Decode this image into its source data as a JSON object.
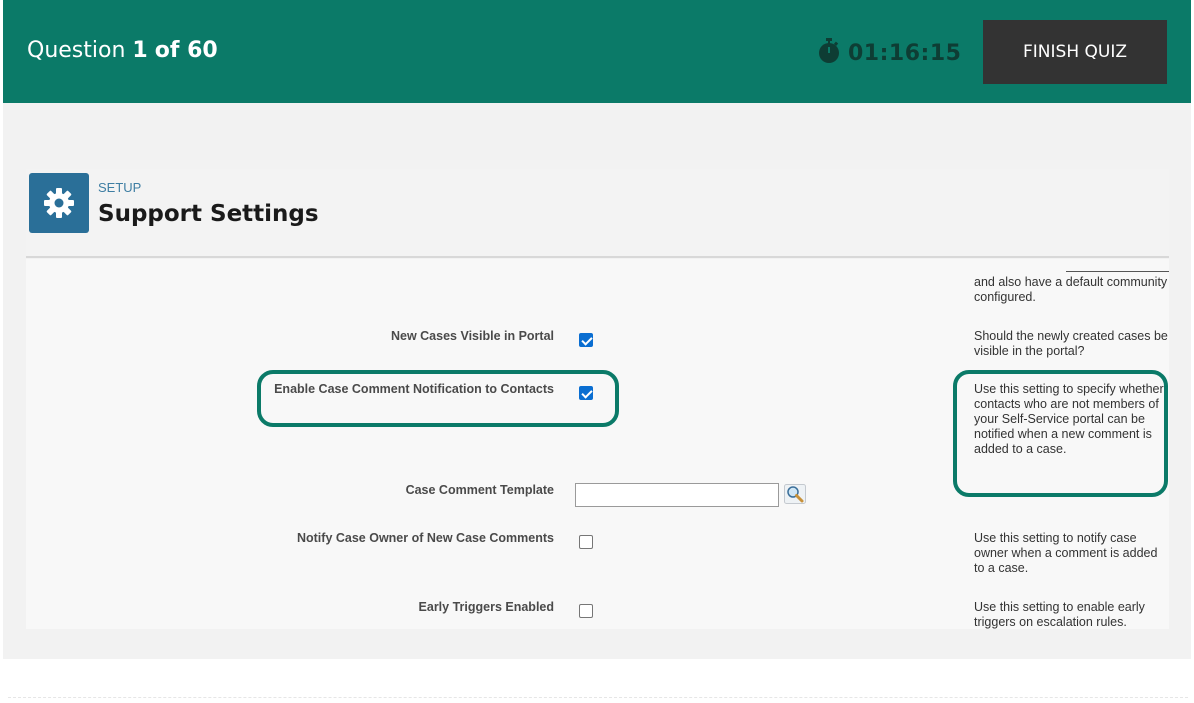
{
  "header": {
    "question_prefix": "Question",
    "question_current": "1",
    "question_of": "of 60",
    "timer": "01:16:15",
    "finish_label": "FINISH QUIZ",
    "bg_color": "#0b7a68"
  },
  "setup": {
    "icon": "gear-icon",
    "small_label": "SETUP",
    "title": "Support Settings"
  },
  "settings": {
    "top_help": "and also have a default community configured.",
    "rows": [
      {
        "label": "New Cases Visible in Portal",
        "checked": true,
        "help": "Should the newly created cases be visible in the portal?"
      },
      {
        "label": "Enable Case Comment Notification to Contacts",
        "checked": true,
        "help": "Use this setting to specify whether contacts who are not members of your Self-Service portal can be notified when a new comment is added to a case."
      },
      {
        "label": "Case Comment Template",
        "value": "",
        "lookup_icon": "lookup-search-icon"
      },
      {
        "label": "Notify Case Owner of New Case Comments",
        "checked": false,
        "help": "Use this setting to notify case owner when a comment is added to a case."
      },
      {
        "label": "Early Triggers Enabled",
        "checked": false,
        "help": "Use this setting to enable early triggers on escalation rules."
      }
    ]
  }
}
